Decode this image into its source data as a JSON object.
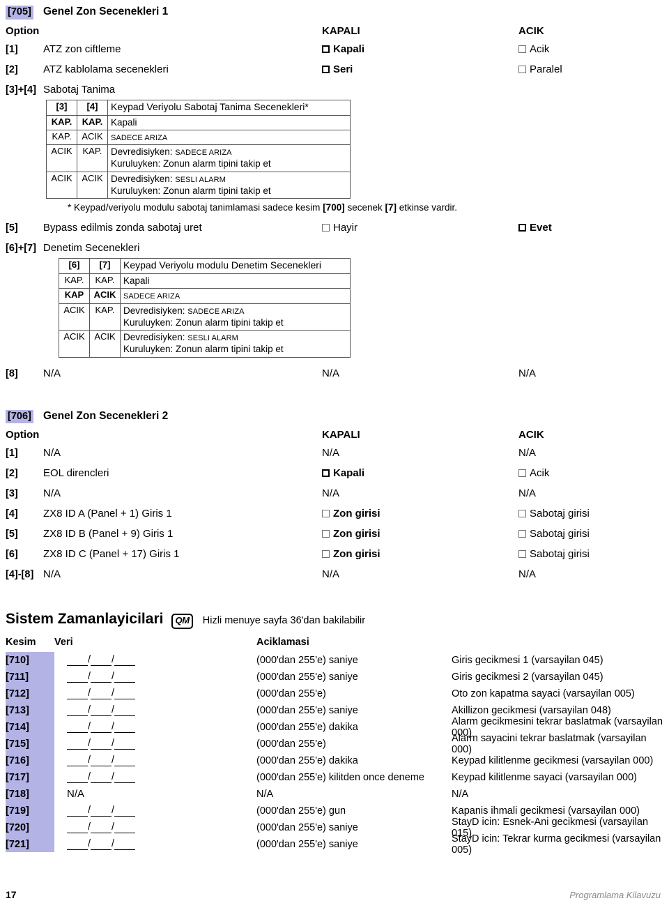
{
  "sections": [
    {
      "code": "[705]",
      "title": "Genel Zon Secenekleri 1",
      "header": {
        "option": "Option",
        "closed": "KAPALI",
        "open": "ACIK"
      },
      "rows": [
        {
          "code": "[1]",
          "desc": "ATZ zon ciftleme",
          "closed": {
            "type": "checkbox",
            "style": "bold",
            "label": "Kapali"
          },
          "open": {
            "type": "checkbox",
            "style": "light",
            "label": "Acik"
          }
        },
        {
          "code": "[2]",
          "desc": "ATZ kablolama secenekleri",
          "closed": {
            "type": "checkbox",
            "style": "bold",
            "label": "Seri"
          },
          "open": {
            "type": "checkbox",
            "style": "light",
            "label": "Paralel"
          }
        },
        {
          "code": "[3]+[4]",
          "desc": "Sabotaj Tanima",
          "closed": null,
          "open": null
        }
      ],
      "subtable1": {
        "headers": [
          "[3]",
          "[4]",
          "Keypad Veriyolu Sabotaj Tanima Secenekleri*"
        ],
        "rows": [
          {
            "k1": "KAP.",
            "k2": "KAP.",
            "bold": true,
            "lines": [
              {
                "text": "Kapali",
                "small": false
              }
            ]
          },
          {
            "k1": "KAP.",
            "k2": "ACIK",
            "bold": false,
            "lines": [
              {
                "text": "SADECE ARIZA",
                "small": true
              }
            ]
          },
          {
            "k1": "ACIK",
            "k2": "KAP.",
            "bold": false,
            "lines": [
              {
                "pre": "Devredisiyken: ",
                "text": "SADECE ARIZA",
                "small": true
              },
              {
                "text": "Kuruluyken: Zonun alarm tipini takip et",
                "small": false
              }
            ]
          },
          {
            "k1": "ACIK",
            "k2": "ACIK",
            "bold": false,
            "lines": [
              {
                "pre": "Devredisiyken: ",
                "text": "SESLI ALARM",
                "small": true
              },
              {
                "text": "Kuruluyken: Zonun alarm tipini takip et",
                "small": false
              }
            ]
          }
        ]
      },
      "footnote": "* Keypad/veriyolu modulu sabotaj tanimlamasi sadece kesim [700] secenek [7] etkinse vardir.",
      "rows2": [
        {
          "code": "[5]",
          "desc": "Bypass edilmis zonda sabotaj uret",
          "closed": {
            "type": "checkbox",
            "style": "light",
            "label": "Hayir"
          },
          "open": {
            "type": "checkbox",
            "style": "bold",
            "label": "Evet"
          }
        },
        {
          "code": "[6]+[7]",
          "desc": "Denetim Secenekleri",
          "closed": null,
          "open": null
        }
      ],
      "subtable2": {
        "headers": [
          "[6]",
          "[7]",
          "Keypad Veriyolu modulu Denetim Secenekleri"
        ],
        "rows": [
          {
            "k1": "KAP.",
            "k2": "KAP.",
            "bold": false,
            "lines": [
              {
                "text": "Kapali",
                "small": false
              }
            ]
          },
          {
            "k1": "KAP",
            "k2": "ACIK",
            "bold": true,
            "lines": [
              {
                "text": "SADECE ARIZA",
                "small": true
              }
            ]
          },
          {
            "k1": "ACIK",
            "k2": "KAP.",
            "bold": false,
            "lines": [
              {
                "pre": "Devredisiyken: ",
                "text": "SADECE ARIZA",
                "small": true
              },
              {
                "text": "Kuruluyken: Zonun alarm tipini takip et",
                "small": false
              }
            ]
          },
          {
            "k1": "ACIK",
            "k2": "ACIK",
            "bold": false,
            "lines": [
              {
                "pre": "Devredisiyken: ",
                "text": "SESLI ALARM",
                "small": true
              },
              {
                "text": "Kuruluyken: Zonun alarm tipini takip et",
                "small": false
              }
            ]
          }
        ]
      },
      "rows3": [
        {
          "code": "[8]",
          "desc": "N/A",
          "closed": {
            "type": "text",
            "label": "N/A"
          },
          "open": {
            "type": "text",
            "label": "N/A"
          }
        }
      ]
    },
    {
      "code": "[706]",
      "title": "Genel Zon Secenekleri 2",
      "header": {
        "option": "Option",
        "closed": "KAPALI",
        "open": "ACIK"
      },
      "rows": [
        {
          "code": "[1]",
          "desc": "N/A",
          "closed": {
            "type": "text",
            "label": "N/A"
          },
          "open": {
            "type": "text",
            "label": "N/A"
          }
        },
        {
          "code": "[2]",
          "desc": "EOL direncleri",
          "closed": {
            "type": "checkbox",
            "style": "bold",
            "label": "Kapali"
          },
          "open": {
            "type": "checkbox",
            "style": "light",
            "label": "Acik"
          }
        },
        {
          "code": "[3]",
          "desc": "N/A",
          "closed": {
            "type": "text",
            "label": "N/A"
          },
          "open": {
            "type": "text",
            "label": "N/A"
          }
        },
        {
          "code": "[4]",
          "desc": "ZX8 ID A (Panel + 1) Giris 1",
          "closed": {
            "type": "checkbox",
            "style": "light",
            "labelBold": true,
            "label": "Zon girisi"
          },
          "open": {
            "type": "checkbox",
            "style": "light",
            "label": "Sabotaj girisi"
          }
        },
        {
          "code": "[5]",
          "desc": "ZX8 ID B (Panel + 9) Giris 1",
          "closed": {
            "type": "checkbox",
            "style": "light",
            "labelBold": true,
            "label": "Zon girisi"
          },
          "open": {
            "type": "checkbox",
            "style": "light",
            "label": "Sabotaj girisi"
          }
        },
        {
          "code": "[6]",
          "desc": "ZX8 ID C (Panel + 17) Giris 1",
          "closed": {
            "type": "checkbox",
            "style": "light",
            "labelBold": true,
            "label": "Zon girisi"
          },
          "open": {
            "type": "checkbox",
            "style": "light",
            "label": "Sabotaj girisi"
          }
        },
        {
          "code": "[4]-[8]",
          "desc": "N/A",
          "closed": {
            "type": "text",
            "label": "N/A"
          },
          "open": {
            "type": "text",
            "label": "N/A"
          }
        }
      ]
    }
  ],
  "timers": {
    "title": "Sistem Zamanlayicilari",
    "badge": "QM",
    "note": "Hizli menuye sayfa 36'dan bakilabilir",
    "headers": {
      "kesim": "Kesim",
      "veri": "Veri",
      "aciklamasi": "Aciklamasi"
    },
    "rows": [
      {
        "code": "[710]",
        "veri": "(000'dan 255'e) saniye",
        "blanks": true,
        "desc": "Giris gecikmesi 1 (varsayilan 045)"
      },
      {
        "code": "[711]",
        "veri": "(000'dan 255'e) saniye",
        "blanks": true,
        "desc": "Giris gecikmesi 2 (varsayilan 045)"
      },
      {
        "code": "[712]",
        "veri": "(000'dan 255'e)",
        "blanks": true,
        "desc": "Oto zon kapatma sayaci (varsayilan 005)"
      },
      {
        "code": "[713]",
        "veri": "(000'dan 255'e) saniye",
        "blanks": true,
        "desc": "Akillizon gecikmesi (varsayilan 048)"
      },
      {
        "code": "[714]",
        "veri": "(000'dan 255'e) dakika",
        "blanks": true,
        "desc": "Alarm gecikmesini tekrar baslatmak (varsayilan 000)"
      },
      {
        "code": "[715]",
        "veri": "(000'dan 255'e)",
        "blanks": true,
        "desc": "Alarm sayacini tekrar baslatmak (varsayilan 000)"
      },
      {
        "code": "[716]",
        "veri": "(000'dan 255'e) dakika",
        "blanks": true,
        "desc": "Keypad kilitlenme gecikmesi (varsayilan 000)"
      },
      {
        "code": "[717]",
        "veri": "(000'dan 255'e) kilitden once deneme",
        "blanks": true,
        "desc": "Keypad kilitlenme sayaci (varsayilan 000)"
      },
      {
        "code": "[718]",
        "veri": "N/A",
        "blanks": false,
        "blanksText": "N/A",
        "desc": "N/A"
      },
      {
        "code": "[719]",
        "veri": "(000'dan 255'e) gun",
        "blanks": true,
        "desc": "Kapanis ihmali gecikmesi (varsayilan 000)"
      },
      {
        "code": "[720]",
        "veri": "(000'dan 255'e) saniye",
        "blanks": true,
        "desc": "StayD icin: Esnek-Ani gecikmesi (varsayilan 015)"
      },
      {
        "code": "[721]",
        "veri": "(000'dan 255'e) saniye",
        "blanks": true,
        "desc": "StayD icin: Tekrar kurma gecikmesi (varsayilan 005)"
      }
    ]
  },
  "footer": {
    "page": "17",
    "guide": "Programlama Kilavuzu"
  },
  "colors": {
    "section_highlight": "#b3b3e6",
    "footer_text": "#8a8a8a"
  }
}
